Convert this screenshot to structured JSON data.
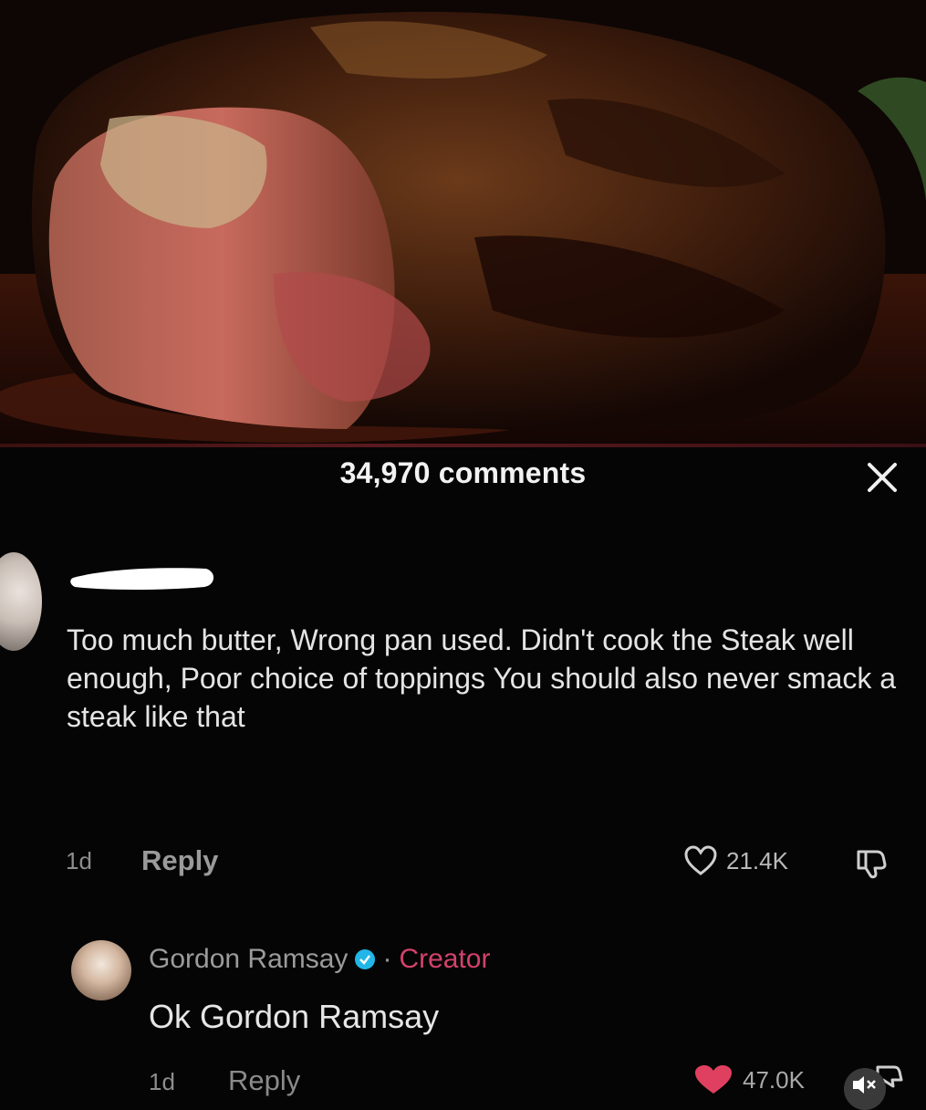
{
  "video": {
    "subject": "seared-steak-thumbnail"
  },
  "header": {
    "comments_count_label": "34,970 comments",
    "close_icon": "close-icon"
  },
  "comments": [
    {
      "author": "",
      "text": "Too much butter, Wrong pan used. Didn't cook the Steak well enough, Poor choice of toppings You should also never smack a steak like that",
      "time": "1d",
      "reply_label": "Reply",
      "likes": "21.4K"
    }
  ],
  "reply": {
    "author": "Gordon Ramsay",
    "separator": "·",
    "badge": "Creator",
    "text": "Ok Gordon Ramsay",
    "time": "1d",
    "reply_label": "Reply",
    "likes": "47.0K"
  },
  "colors": {
    "background": "#050505",
    "creator_badge": "#d3426a",
    "liked_heart": "#e0405f",
    "verified": "#22b6e8"
  }
}
